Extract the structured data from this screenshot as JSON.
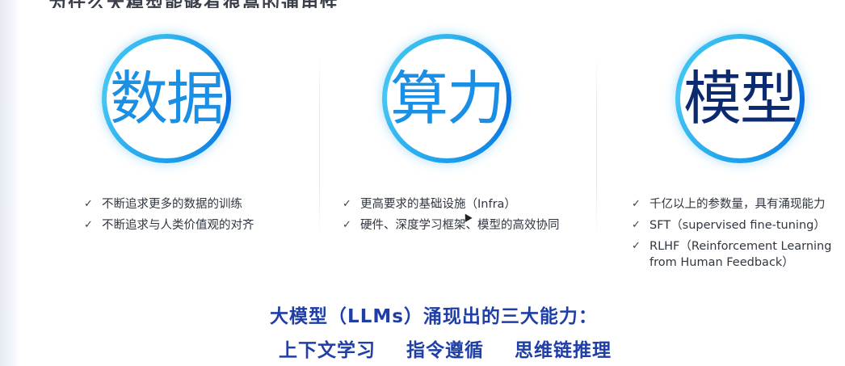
{
  "heading": "为什么大模型能够有很高的通用性",
  "pillars": [
    {
      "title": "数据",
      "points": [
        "不断追求更多的数据的训练",
        "不断追求与人类价值观的对齐"
      ]
    },
    {
      "title": "算力",
      "points": [
        "更高要求的基础设施（Infra）",
        "硬件、深度学习框架、模型的高效协同"
      ]
    },
    {
      "title": "模型",
      "points": [
        "千亿以上的参数量，具有涌现能力",
        "SFT（supervised fine-tuning）",
        "RLHF（Reinforcement Learning",
        "from Human Feedback）"
      ]
    }
  ],
  "caption": {
    "line1": "大模型（LLMs）涌现出的三大能力：",
    "abilities": [
      "上下文学习",
      "指令遵循",
      "思维链推理"
    ]
  },
  "colors": {
    "ring_blue": "#1ea0ea",
    "title_blue": "#1b8fe4",
    "title_navy": "#0c2a70",
    "caption_blue": "#1f3fa6"
  },
  "icons": {
    "bullet": "check-icon",
    "pointer": "mouse-cursor-icon"
  }
}
